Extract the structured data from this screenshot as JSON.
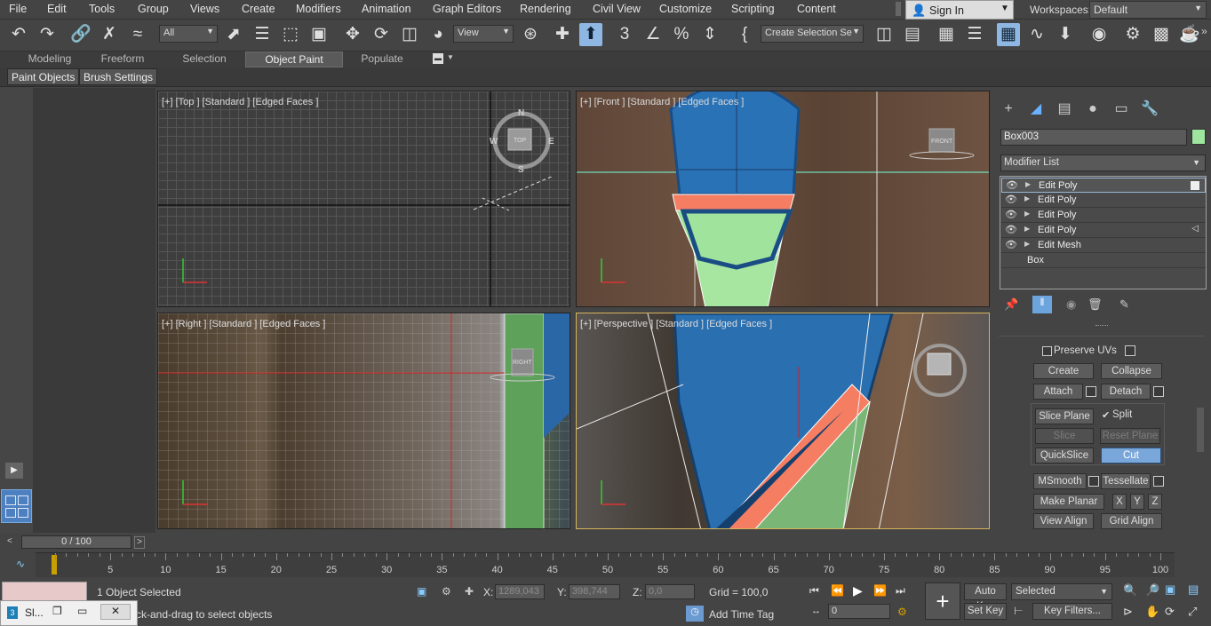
{
  "menu": [
    "File",
    "Edit",
    "Tools",
    "Group",
    "Views",
    "Create",
    "Modifiers",
    "Animation",
    "Graph Editors",
    "Rendering",
    "Civil View",
    "Customize",
    "Scripting",
    "Content"
  ],
  "signin": {
    "label": "Sign In"
  },
  "workspaces": {
    "label": "Workspaces:",
    "value": "Default"
  },
  "toolbar": {
    "filter_value": "All",
    "refcoord_value": "View",
    "selection_set_placeholder": "Create Selection Se",
    "icons": [
      "undo-icon",
      "redo-icon",
      "link-icon",
      "unlink-icon",
      "bind-spacewarp-icon",
      "select-object-icon",
      "select-by-name-icon",
      "rect-region-icon",
      "window-crossing-icon",
      "move-icon",
      "rotate-icon",
      "scale-icon",
      "place-icon",
      "use-pivot-icon",
      "select-manipulate-icon",
      "snap-3d-icon",
      "angle-snap-icon",
      "percent-snap-icon",
      "spinner-snap-icon",
      "edit-named-sets-icon",
      "mirror-icon",
      "align-icon",
      "scene-explorer-icon",
      "layer-explorer-icon",
      "ribbon-toggle-icon",
      "curve-editor-icon",
      "schematic-view-icon",
      "material-editor-icon",
      "render-setup-icon",
      "rendered-frame-icon",
      "render-icon"
    ]
  },
  "ribbon": {
    "tabs": [
      "Modeling",
      "Freeform",
      "Selection",
      "Object Paint",
      "Populate"
    ],
    "active_tab": "Object Paint",
    "sub": [
      "Paint Objects",
      "Brush Settings"
    ]
  },
  "viewports": {
    "top": "[+] [Top ] [Standard ] [Edged Faces ]",
    "front": "[+] [Front ] [Standard ] [Edged Faces ]",
    "right": "[+] [Right ] [Standard ] [Edged Faces ]",
    "perspective": "[+] [Perspective ] [Standard ] [Edged Faces ]",
    "cube_top": "TOP",
    "cube_front": "FRONT",
    "cube_right": "RIGHT",
    "compass": {
      "n": "N",
      "s": "S",
      "w": "W",
      "e": "E"
    }
  },
  "command_panel": {
    "object_name": "Box003",
    "object_color": "#9ee6a0",
    "modifier_list": "Modifier List",
    "stack": [
      "Edit Poly",
      "Edit Poly",
      "Edit Poly",
      "Edit Poly",
      "Edit Mesh",
      "Box"
    ],
    "preserve_uvs": "Preserve UVs",
    "buttons": {
      "create": "Create",
      "collapse": "Collapse",
      "attach": "Attach",
      "detach": "Detach",
      "slice_plane": "Slice Plane",
      "split": "Split",
      "slice": "Slice",
      "reset_plane": "Reset Plane",
      "quickslice": "QuickSlice",
      "cut": "Cut",
      "msmooth": "MSmooth",
      "tessellate": "Tessellate",
      "make_planar": "Make Planar",
      "x": "X",
      "y": "Y",
      "z": "Z",
      "view_align": "View Align",
      "grid_align": "Grid Align"
    },
    "split_checked": true
  },
  "timeline": {
    "slider": "0 / 100",
    "ticks": [
      "5",
      "10",
      "15",
      "20",
      "25",
      "30",
      "35",
      "40",
      "45",
      "50",
      "55",
      "60",
      "65",
      "70",
      "75",
      "80",
      "85",
      "90",
      "95",
      "100"
    ]
  },
  "status": {
    "selected": "1 Object Selected",
    "prompt": "ck-and-drag to select objects",
    "x_label": "X:",
    "x_value": "1289,043",
    "y_label": "Y:",
    "y_value": "398,744",
    "z_label": "Z:",
    "z_value": "0,0",
    "grid": "Grid = 100,0",
    "add_time_tag": "Add Time Tag",
    "frame": "0",
    "auto_key": "Auto Key",
    "set_key": "Set Key",
    "key_mode": "Selected",
    "key_filters": "Key Filters..."
  },
  "taskbar": {
    "title": "Sl..."
  }
}
